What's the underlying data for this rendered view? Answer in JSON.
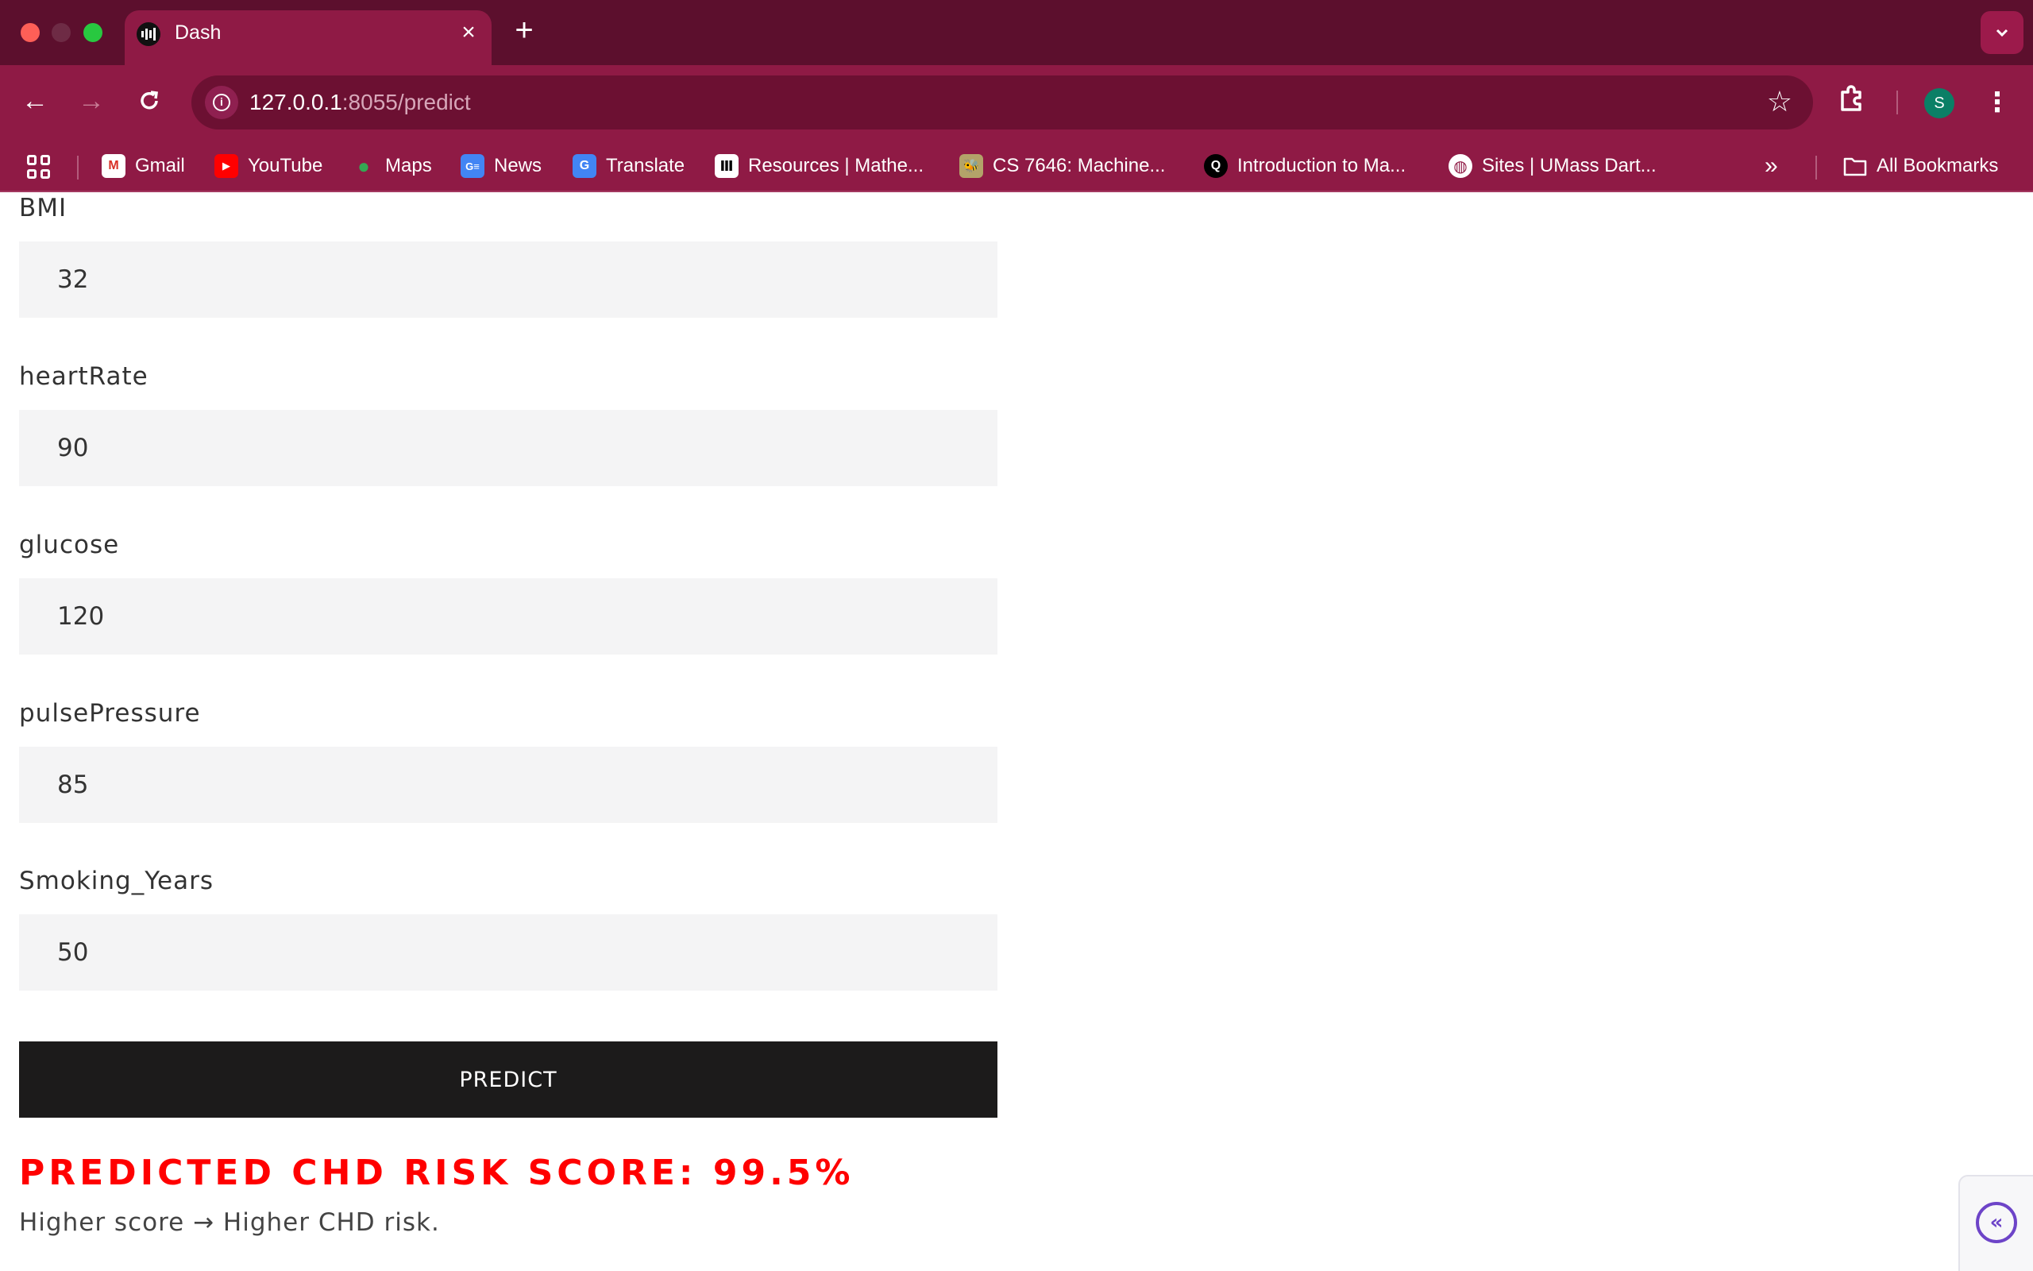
{
  "browser": {
    "tab_title": "Dash",
    "url_host": "127.0.0.1",
    "url_path": ":8055/predict",
    "profile_initial": "S",
    "bookmarks": [
      {
        "label": "Gmail",
        "icon": "gmail-icon"
      },
      {
        "label": "YouTube",
        "icon": "youtube-icon"
      },
      {
        "label": "Maps",
        "icon": "maps-icon"
      },
      {
        "label": "News",
        "icon": "news-icon"
      },
      {
        "label": "Translate",
        "icon": "translate-icon"
      },
      {
        "label": "Resources | Mathe...",
        "icon": "resources-icon"
      },
      {
        "label": "CS 7646: Machine...",
        "icon": "cs7646-icon"
      },
      {
        "label": "Introduction to Ma...",
        "icon": "intro-icon"
      },
      {
        "label": "Sites | UMass Dart...",
        "icon": "globe-icon"
      }
    ],
    "all_bookmarks_label": "All Bookmarks",
    "colors": {
      "titlebar": "#5c0f2d",
      "toolbar": "#8f1a45",
      "omnibox": "#6c1032"
    }
  },
  "form": {
    "fields": [
      {
        "label": "BMI",
        "value": "32"
      },
      {
        "label": "heartRate",
        "value": "90"
      },
      {
        "label": "glucose",
        "value": "120"
      },
      {
        "label": "pulsePressure",
        "value": "85"
      },
      {
        "label": "Smoking_Years",
        "value": "50"
      }
    ],
    "predict_label": "PREDICT"
  },
  "result": {
    "score_text": "PREDICTED CHD RISK SCORE: 99.5%",
    "score_color": "#ff0000",
    "note": "Higher score → Higher CHD risk."
  }
}
